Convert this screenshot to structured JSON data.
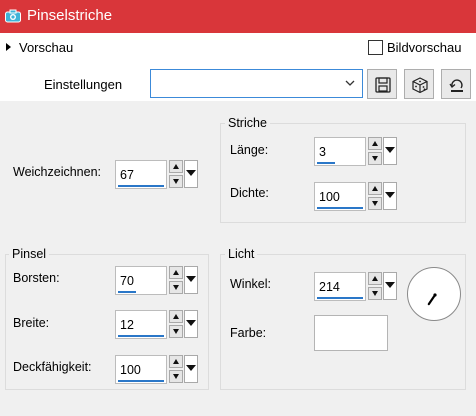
{
  "window": {
    "title": "Pinselstriche",
    "icon": "camera-icon",
    "accent": "#d9363a"
  },
  "preview": {
    "label": "Vorschau",
    "bild_label": "Bildvorschau",
    "bild_checked": false
  },
  "settings": {
    "label": "Einstellungen",
    "value": "",
    "buttons": [
      "save-icon",
      "dice-icon",
      "reset-icon"
    ]
  },
  "stroke": {
    "group_title": "Striche",
    "length_label": "Länge:",
    "length_value": "3",
    "density_label": "Dichte:",
    "density_value": "100"
  },
  "soften": {
    "label": "Weichzeichnen:",
    "value": "67"
  },
  "brush": {
    "group_title": "Pinsel",
    "bristles_label": "Borsten:",
    "bristles_value": "70",
    "width_label": "Breite:",
    "width_value": "12",
    "opacity_label": "Deckfähigkeit:",
    "opacity_value": "100"
  },
  "light": {
    "group_title": "Licht",
    "angle_label": "Winkel:",
    "angle_value": "214",
    "angle_degrees": 214,
    "color_label": "Farbe:",
    "color_value": "#ffffff"
  }
}
